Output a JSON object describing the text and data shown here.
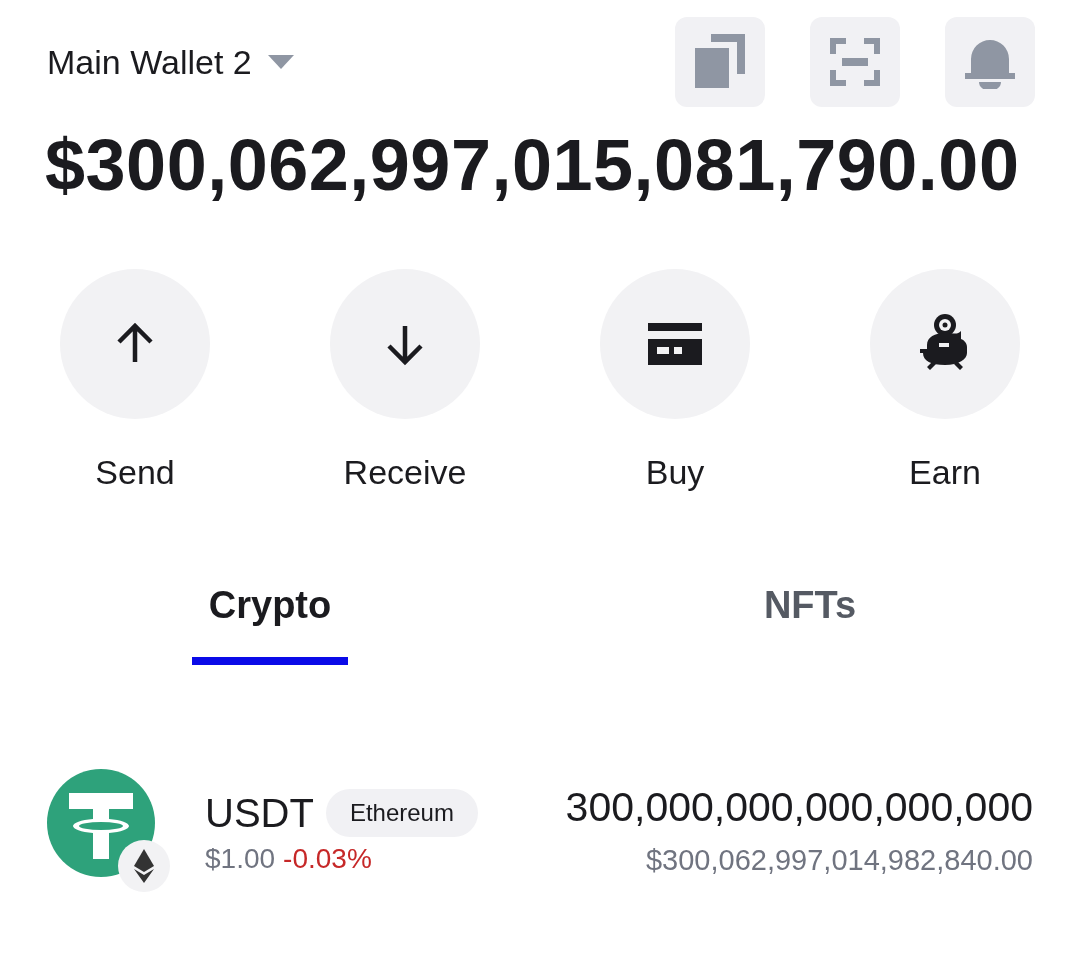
{
  "wallet": {
    "name": "Main Wallet 2"
  },
  "balance": "$300,062,997,015,081,790.00",
  "actions": [
    {
      "label": "Send"
    },
    {
      "label": "Receive"
    },
    {
      "label": "Buy"
    },
    {
      "label": "Earn"
    }
  ],
  "tabs": [
    {
      "label": "Crypto",
      "selected": true
    },
    {
      "label": "NFTs",
      "selected": false
    }
  ],
  "assets": [
    {
      "symbol": "USDT",
      "network": "Ethereum",
      "price": "$1.00",
      "change": "-0.03%",
      "negative": true,
      "amount": "300,000,000,000,000,000",
      "value": "$300,062,997,014,982,840.00"
    }
  ]
}
